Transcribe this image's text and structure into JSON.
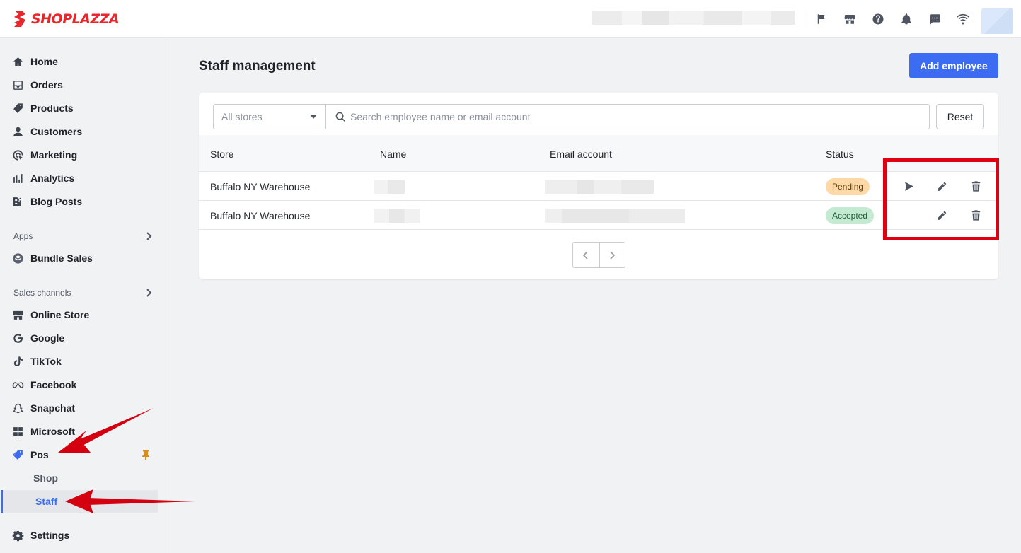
{
  "brand": {
    "name": "SHOPLAZZA",
    "color": "#e8262b"
  },
  "topbar": {
    "icons": [
      "flag-icon",
      "store-icon",
      "help-icon",
      "bell-icon",
      "chat-icon",
      "wifi-icon"
    ]
  },
  "sidebar": {
    "main_items": [
      {
        "label": "Home",
        "icon": "home-icon"
      },
      {
        "label": "Orders",
        "icon": "inbox-icon"
      },
      {
        "label": "Products",
        "icon": "tag-icon"
      },
      {
        "label": "Customers",
        "icon": "person-icon"
      },
      {
        "label": "Marketing",
        "icon": "target-icon"
      },
      {
        "label": "Analytics",
        "icon": "bar-chart-icon"
      },
      {
        "label": "Blog Posts",
        "icon": "blog-icon"
      }
    ],
    "apps_section": "Apps",
    "apps_items": [
      {
        "label": "Bundle Sales",
        "icon": "bundle-icon"
      }
    ],
    "channels_section": "Sales channels",
    "channel_items": [
      {
        "label": "Online Store",
        "icon": "store-icon"
      },
      {
        "label": "Google",
        "icon": "google-icon"
      },
      {
        "label": "TikTok",
        "icon": "tiktok-icon"
      },
      {
        "label": "Facebook",
        "icon": "meta-icon"
      },
      {
        "label": "Snapchat",
        "icon": "snapchat-icon"
      },
      {
        "label": "Microsoft",
        "icon": "windows-icon"
      },
      {
        "label": "Pos",
        "icon": "pos-tag-icon"
      }
    ],
    "pos_sub": [
      {
        "label": "Shop",
        "active": false
      },
      {
        "label": "Staff",
        "active": true
      }
    ],
    "settings": {
      "label": "Settings",
      "icon": "gear-icon"
    }
  },
  "main": {
    "title": "Staff management",
    "add_button": "Add employee",
    "filter": {
      "store_select": "All stores",
      "search_placeholder": "Search employee name or email account",
      "reset_button": "Reset"
    },
    "table": {
      "columns": [
        "Store",
        "Name",
        "Email account",
        "Status"
      ],
      "rows": [
        {
          "store": "Buffalo NY Warehouse",
          "status": "Pending",
          "actions": [
            "send-icon",
            "edit-icon",
            "delete-icon"
          ]
        },
        {
          "store": "Buffalo NY Warehouse",
          "status": "Accepted",
          "actions": [
            "edit-icon",
            "delete-icon"
          ]
        }
      ]
    },
    "accent_color": "#3b6cf2",
    "annotation_color": "#e00010"
  }
}
